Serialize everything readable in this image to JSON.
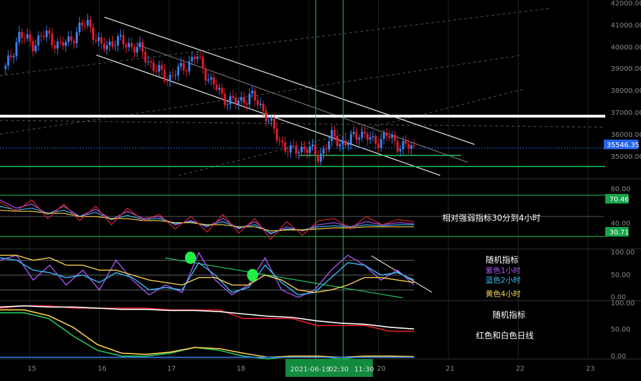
{
  "chart_data": [
    {
      "panel": "price",
      "type": "line",
      "x_ticks": [
        "15",
        "16",
        "17",
        "18",
        "19",
        "20",
        "21",
        "22",
        "23"
      ],
      "y_ticks": [
        "42000.00",
        "41000.00",
        "40000.00",
        "39000.00",
        "38000.00",
        "37000.00",
        "36000.00",
        "35000.00"
      ],
      "ylim": [
        34200,
        42300
      ],
      "last_price": "35546.35",
      "last_price_value": 35546.35,
      "horizontal_levels": [
        {
          "value": 37000,
          "color": "#ffffff"
        },
        {
          "value": 34700,
          "color": "#22c55e"
        }
      ],
      "series": [
        {
          "values": [
            39150,
            40700,
            40300,
            40750,
            40150,
            40650,
            41350,
            40100,
            40450,
            40300,
            39950,
            39100,
            38750,
            39200,
            39750,
            38650,
            37850,
            37600,
            37950,
            37250,
            35950,
            35350,
            35600,
            35150,
            36050,
            35700,
            36300,
            35800,
            36100,
            35650,
            35546
          ]
        }
      ],
      "candle_colors": {
        "up": "#3b82f6",
        "down": "#e11d2a"
      }
    },
    {
      "panel": "rsi",
      "type": "line",
      "y_ticks": [
        "80.00",
        "40.00"
      ],
      "ylim": [
        20,
        85
      ],
      "levels": [
        {
          "label": "70.46",
          "value": 70.46
        },
        {
          "label": "30.71",
          "value": 30.71
        }
      ],
      "annotation": "相对强弱指标30分到4小时",
      "series": [
        {
          "color": "#a855f7",
          "values": [
            66,
            58,
            62,
            52,
            60,
            50,
            57,
            47,
            55,
            48,
            50,
            42,
            46,
            40,
            48,
            38,
            45,
            33,
            40,
            36,
            42,
            44,
            40,
            45,
            42,
            44,
            43
          ]
        },
        {
          "color": "#38bdf8",
          "values": [
            60,
            56,
            58,
            53,
            56,
            50,
            54,
            47,
            51,
            47,
            48,
            43,
            45,
            41,
            45,
            39,
            42,
            34,
            38,
            37,
            40,
            41,
            40,
            42,
            41,
            42,
            42
          ]
        },
        {
          "color": "#fcd34d",
          "values": [
            56,
            55,
            55,
            53,
            53,
            50,
            50,
            48,
            48,
            46,
            46,
            44,
            44,
            42,
            42,
            40,
            40,
            36,
            37,
            37,
            38,
            39,
            39,
            40,
            40,
            40,
            40
          ]
        },
        {
          "color": "#dc2626",
          "values": [
            64,
            55,
            66,
            48,
            62,
            46,
            60,
            42,
            58,
            46,
            52,
            38,
            50,
            35,
            52,
            34,
            48,
            28,
            45,
            32,
            46,
            48,
            38,
            50,
            42,
            47,
            45
          ]
        }
      ]
    },
    {
      "panel": "stochastic",
      "type": "line",
      "y_ticks": [
        "100.00",
        "50.00",
        "0.00"
      ],
      "ylim": [
        0,
        100
      ],
      "annotation": {
        "title": "随机指标",
        "lines": [
          "紫色1小时",
          "蓝色2小时",
          "黄色4小时"
        ]
      },
      "series": [
        {
          "name": "紫色1小时",
          "color": "#a855f7",
          "values": [
            80,
            90,
            40,
            70,
            30,
            60,
            20,
            80,
            40,
            10,
            30,
            15,
            95,
            40,
            10,
            30,
            85,
            20,
            5,
            20,
            60,
            90,
            70,
            40,
            60,
            30
          ]
        },
        {
          "name": "蓝色2小时",
          "color": "#38bdf8",
          "values": [
            85,
            80,
            60,
            55,
            45,
            50,
            35,
            55,
            45,
            20,
            25,
            20,
            75,
            50,
            15,
            25,
            70,
            35,
            10,
            15,
            45,
            75,
            70,
            50,
            55,
            40
          ]
        },
        {
          "name": "黄色4小时",
          "color": "#fcd34d",
          "values": [
            90,
            90,
            80,
            85,
            70,
            70,
            60,
            60,
            50,
            40,
            35,
            30,
            45,
            45,
            30,
            30,
            50,
            40,
            20,
            15,
            20,
            30,
            45,
            45,
            40,
            35
          ]
        }
      ],
      "markers": [
        {
          "x": 0.46,
          "y": 85
        },
        {
          "x": 0.61,
          "y": 50
        }
      ]
    },
    {
      "panel": "stochastic_daily",
      "type": "line",
      "y_ticks": [
        "100.00",
        "50.00",
        "0.00"
      ],
      "ylim": [
        0,
        100
      ],
      "annotation": {
        "title": "随机指标",
        "lines": [
          "红色和白色日线"
        ]
      },
      "series": [
        {
          "color": "#e11d2a",
          "values": [
            88,
            92,
            92,
            88,
            88,
            88,
            88,
            85,
            85,
            85,
            70,
            70,
            70,
            58,
            58,
            58,
            48,
            48
          ]
        },
        {
          "color": "#ffffff",
          "values": [
            90,
            92,
            90,
            90,
            88,
            86,
            86,
            84,
            84,
            82,
            78,
            74,
            72,
            66,
            62,
            60,
            55,
            52
          ]
        },
        {
          "color": "#22c55e",
          "values": [
            80,
            80,
            70,
            40,
            15,
            5,
            5,
            10,
            20,
            15,
            5,
            0,
            5,
            5,
            0,
            5,
            5,
            3
          ]
        },
        {
          "color": "#fcd34d",
          "values": [
            85,
            85,
            75,
            55,
            25,
            10,
            8,
            12,
            20,
            18,
            10,
            3,
            5,
            5,
            3,
            5,
            5,
            4
          ]
        },
        {
          "color": "#3b82f6",
          "values": [
            3,
            3,
            3,
            3,
            3,
            3,
            3,
            3,
            3,
            3,
            3,
            3,
            3,
            3,
            3,
            3,
            3,
            3
          ]
        }
      ]
    }
  ],
  "cursor": {
    "date_label": "2021-06-19",
    "time_label": "02:30",
    "time_label2": "11:30"
  },
  "colors": {
    "background": "#000000",
    "grid": "#1f3a2a",
    "axis_text": "#888888",
    "crosshair": "#22c55e",
    "price_badge": "#2563eb",
    "level_badge": "#16a34a"
  }
}
